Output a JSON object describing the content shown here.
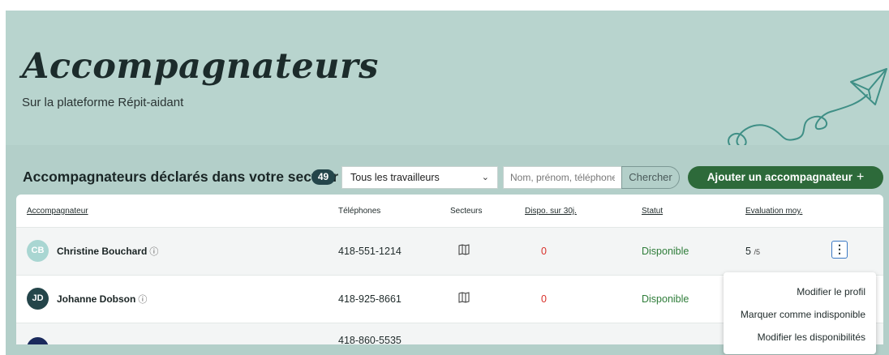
{
  "hero": {
    "title": "Accompagnateurs",
    "subtitle": "Sur la plateforme Répit-aidant"
  },
  "toolbar": {
    "section_title": "Accompagnateurs déclarés dans votre secteur",
    "count": "49",
    "filter_selected": "Tous les travailleurs",
    "search_placeholder": "Nom, prénom, téléphone",
    "search_button": "Chercher",
    "add_button": "Ajouter un accompagnateur",
    "add_icon": "plus-icon"
  },
  "table": {
    "headers": {
      "accompagnateur": "Accompagnateur",
      "telephones": "Téléphones",
      "secteurs": "Secteurs",
      "dispo": "Dispo. sur 30j.",
      "statut": "Statut",
      "evaluation": "Evaluation moy."
    },
    "rows": [
      {
        "initials": "CB",
        "name": "Christine Bouchard",
        "info_icon": "ⓘ",
        "phone": "418-551-1214",
        "dispo": "0",
        "statut": "Disponible",
        "eval": "5",
        "eval_max": "/5",
        "avatar_color": "#a9d6d2"
      },
      {
        "initials": "JD",
        "name": "Johanne Dobson",
        "info_icon": "ⓘ",
        "phone": "418-925-8661",
        "dispo": "0",
        "statut": "Disponible",
        "eval": "",
        "eval_max": "",
        "avatar_color": "#24454a"
      },
      {
        "initials": "",
        "name": "",
        "info_icon": "",
        "phone": "418-860-5535",
        "dispo": "",
        "statut": "",
        "eval": "",
        "eval_max": "",
        "avatar_color": "#1a2a5c"
      }
    ]
  },
  "context_menu": {
    "items": [
      "Modifier le profil",
      "Marquer comme indisponible",
      "Modifier les disponibilités"
    ]
  },
  "colors": {
    "hero_bg": "#b8d4ce",
    "primary_button": "#2d6a3a",
    "status_ok": "#2f7d3a",
    "dispo_zero": "#d9302a",
    "badge_bg": "#24454a"
  }
}
